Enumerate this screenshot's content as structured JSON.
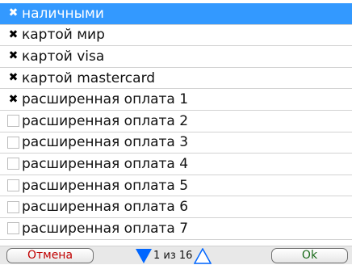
{
  "list": {
    "items": [
      {
        "label": "наличными",
        "checked": true,
        "selected": true
      },
      {
        "label": "картой мир",
        "checked": true,
        "selected": false
      },
      {
        "label": "картой visa",
        "checked": true,
        "selected": false
      },
      {
        "label": "картой mastercard",
        "checked": true,
        "selected": false
      },
      {
        "label": "расширенная оплата 1",
        "checked": true,
        "selected": false
      },
      {
        "label": "расширенная оплата 2",
        "checked": false,
        "selected": false
      },
      {
        "label": "расширенная оплата 3",
        "checked": false,
        "selected": false
      },
      {
        "label": "расширенная оплата 4",
        "checked": false,
        "selected": false
      },
      {
        "label": "расширенная оплата 5",
        "checked": false,
        "selected": false
      },
      {
        "label": "расширенная оплата 6",
        "checked": false,
        "selected": false
      },
      {
        "label": "расширенная оплата 7",
        "checked": false,
        "selected": false
      }
    ]
  },
  "footer": {
    "cancel_label": "Отмена",
    "pager_text": "1 из 16",
    "ok_label": "Ok"
  },
  "colors": {
    "selection": "#3399ff",
    "cancel_text": "#c00000",
    "ok_text": "#1a6b1a",
    "arrow_down": "#0066ff",
    "arrow_up_outline": "#0066ff"
  },
  "icons": {
    "checked": "cross-mark-icon",
    "page_down": "triangle-down-icon",
    "page_up": "triangle-up-outline-icon"
  }
}
